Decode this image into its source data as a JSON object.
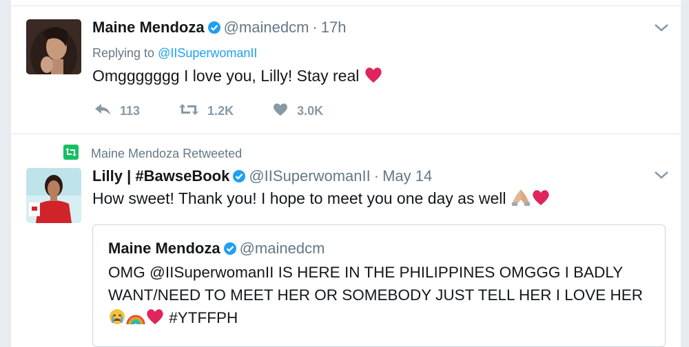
{
  "tweet1": {
    "fullname": "Maine Mendoza",
    "handle": "@mainedcm",
    "time": "17h",
    "reply_label": "Replying to",
    "reply_handle": "@IISuperwomanII",
    "text": "Omggggggg I love you, Lilly! Stay real",
    "reply_count": "113",
    "retweet_count": "1.2K",
    "like_count": "3.0K"
  },
  "tweet2": {
    "retweet_context": "Maine Mendoza Retweeted",
    "fullname": "Lilly | #BawseBook",
    "handle": "@IISuperwomanII",
    "time": "May 14",
    "text": "How sweet! Thank you! I hope to meet you one day as well",
    "quote": {
      "fullname": "Maine Mendoza",
      "handle": "@mainedcm",
      "text": "OMG @IISuperwomanII IS HERE IN THE PHILIPPINES OMGGG I BADLY WANT/NEED TO MEET HER OR SOMEBODY JUST TELL HER I LOVE HER",
      "hashtag": "#YTFFPH"
    }
  },
  "icons": {
    "verified": "verified-badge-icon",
    "chevron": "chevron-down-icon",
    "reply": "reply-icon",
    "retweet": "retweet-icon",
    "like": "heart-icon"
  },
  "colors": {
    "link": "#1da1f2",
    "muted": "#657786",
    "action": "#8899a6",
    "heart": "#e0245e",
    "retweet_green": "#17bf63"
  }
}
